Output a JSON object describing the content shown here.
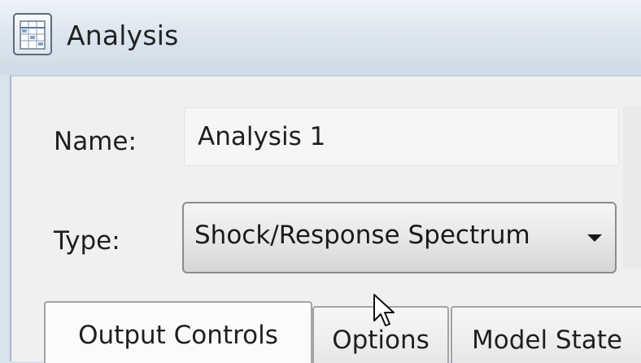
{
  "window": {
    "title": "Analysis",
    "icon": "table-icon"
  },
  "form": {
    "name_label": "Name:",
    "name_value": "Analysis 1",
    "type_label": "Type:",
    "type_selected": "Shock/Response Spectrum"
  },
  "tabs": [
    {
      "label": "Output Controls",
      "active": true
    },
    {
      "label": "Options",
      "active": false
    },
    {
      "label": "Model State",
      "active": false
    }
  ],
  "cursor": {
    "icon": "arrow-pointer-icon"
  }
}
